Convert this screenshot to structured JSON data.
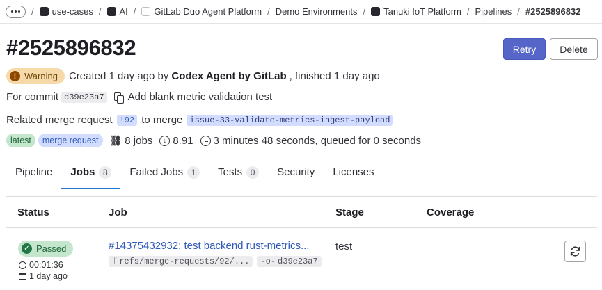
{
  "breadcrumb": {
    "items": [
      "use-cases",
      "AI",
      "GitLab Duo Agent Platform",
      "Demo Environments",
      "Tanuki IoT Platform",
      "Pipelines"
    ],
    "current": "#2525896832"
  },
  "header": {
    "title": "#2525896832",
    "retry_label": "Retry",
    "delete_label": "Delete"
  },
  "pipeline": {
    "status": "Warning",
    "created_prefix": "Created 1 day ago by",
    "author": "Codex Agent by GitLab",
    "finished": ", finished 1 day ago",
    "commit_prefix": "For commit",
    "commit_sha": "d39e23a7",
    "commit_title": "Add blank metric validation test",
    "mr_prefix": "Related merge request",
    "mr_ref": "!92",
    "mr_to": "to merge",
    "branch": "issue-33-validate-metrics-ingest-payload",
    "tag_latest": "latest",
    "tag_mr": "merge request",
    "jobs": "8 jobs",
    "score": "8.91",
    "duration": "3 minutes 48 seconds, queued for 0 seconds"
  },
  "tabs": [
    {
      "label": "Pipeline",
      "count": null
    },
    {
      "label": "Jobs",
      "count": "8"
    },
    {
      "label": "Failed Jobs",
      "count": "1"
    },
    {
      "label": "Tests",
      "count": "0"
    },
    {
      "label": "Security",
      "count": null
    },
    {
      "label": "Licenses",
      "count": null
    }
  ],
  "table": {
    "columns": [
      "Status",
      "Job",
      "Stage",
      "Coverage"
    ],
    "rows": [
      {
        "status": "Passed",
        "duration": "00:01:36",
        "finished": "1 day ago",
        "job": "#14375432932: test backend rust-metrics...",
        "ref": "refs/merge-requests/92/...",
        "sha": "d39e23a7",
        "stage": "test",
        "coverage": ""
      }
    ]
  },
  "colors": {
    "primary": "#5565c8",
    "link": "#2f5ab8",
    "warning_bg": "#f5d9a8",
    "success_bg": "#c3e6cd"
  }
}
